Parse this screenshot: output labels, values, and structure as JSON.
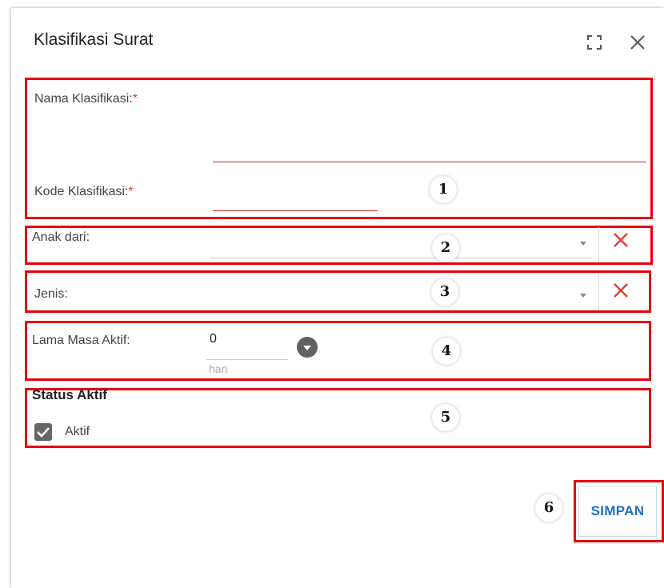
{
  "dialog": {
    "title": "Klasifikasi Surat"
  },
  "form": {
    "nama_label": "Nama Klasifikasi:",
    "kode_label": "Kode Klasifikasi:",
    "required_mark": "*",
    "nama_value": "",
    "kode_value": "",
    "anak_dari_label": "Anak dari:",
    "jenis_label": "Jenis:",
    "lama_label": "Lama Masa Aktif:",
    "lama_value": "0",
    "lama_unit": "hari",
    "status_title": "Status Aktif",
    "aktif_label": "Aktif",
    "aktif_checked": true
  },
  "actions": {
    "save_label": "SIMPAN"
  },
  "annotations": [
    "1",
    "2",
    "3",
    "4",
    "5",
    "6"
  ],
  "colors": {
    "annotation_red": "#e8000d",
    "required_red": "#e53935",
    "primary_blue": "#1e6fc8"
  }
}
